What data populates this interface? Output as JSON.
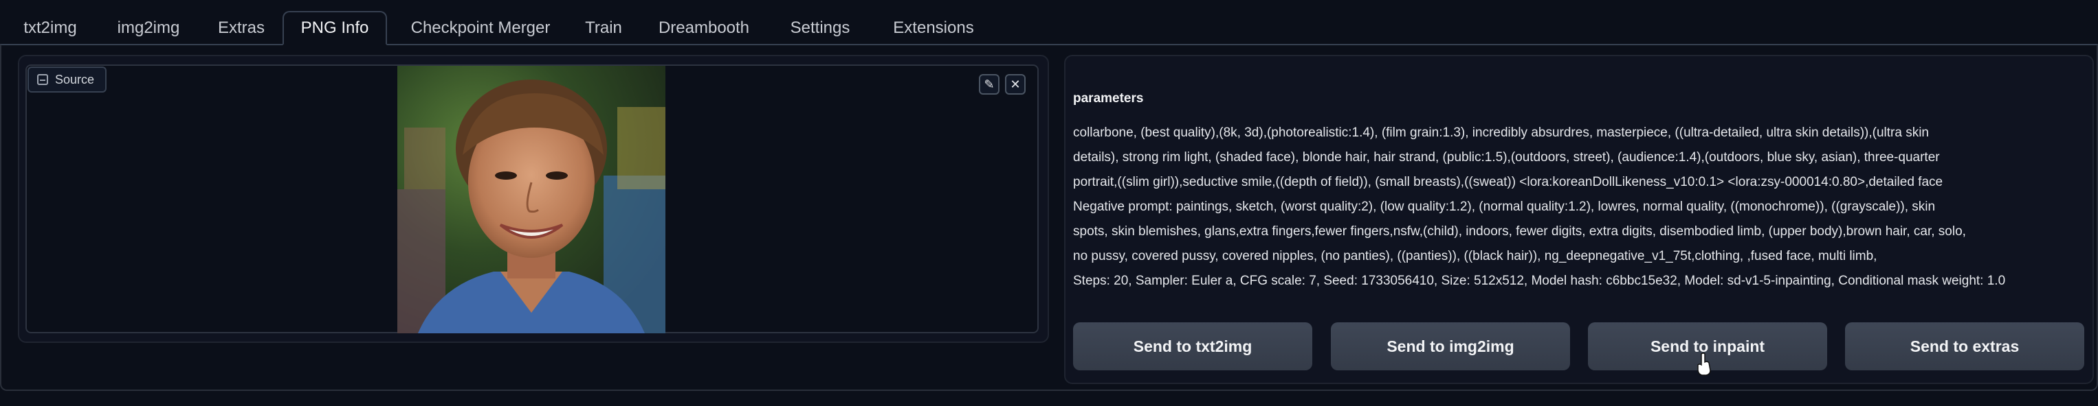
{
  "tabs": [
    {
      "label": "txt2img"
    },
    {
      "label": "img2img"
    },
    {
      "label": "Extras"
    },
    {
      "label": "PNG Info"
    },
    {
      "label": "Checkpoint Merger"
    },
    {
      "label": "Train"
    },
    {
      "label": "Dreambooth"
    },
    {
      "label": "Settings"
    },
    {
      "label": "Extensions"
    }
  ],
  "image_panel": {
    "source_label": "Source",
    "edit_icon": "pencil-icon",
    "close_icon": "close-icon",
    "image_alt": "portrait-photo"
  },
  "info": {
    "title": "parameters",
    "lines": [
      "collarbone, (best quality),(8k, 3d),(photorealistic:1.4), (film grain:1.3), incredibly absurdres, masterpiece, ((ultra-detailed, ultra skin details)),(ultra skin",
      "details), strong rim light, (shaded face), blonde hair, hair strand, (public:1.5),(outdoors, street), (audience:1.4),(outdoors, blue sky, asian), three-quarter",
      "portrait,((slim girl)),seductive smile,((depth of field)), (small breasts),((sweat)) <lora:koreanDollLikeness_v10:0.1> <lora:zsy-000014:0.80>,detailed face",
      "Negative prompt: paintings, sketch, (worst quality:2), (low quality:1.2), (normal quality:1.2), lowres, normal quality, ((monochrome)), ((grayscale)), skin",
      "spots, skin blemishes, glans,extra fingers,fewer fingers,nsfw,(child), indoors, fewer digits, extra digits, disembodied limb, (upper body),brown hair, car, solo,",
      "no pussy, covered pussy, covered nipples, (no panties), ((panties)), ((black hair)), ng_deepnegative_v1_75t,clothing, ,fused face, multi limb,",
      "Steps: 20, Sampler: Euler a, CFG scale: 7, Seed: 1733056410, Size: 512x512, Model hash: c6bbc15e32, Model: sd-v1-5-inpainting, Conditional mask weight: 1.0"
    ]
  },
  "buttons": {
    "txt2img": "Send to txt2img",
    "img2img": "Send to img2img",
    "inpaint": "Send to inpaint",
    "extras": "Send to extras"
  },
  "colors": {
    "background": "#0b0f19",
    "panel": "#0f1320",
    "button": "#374151",
    "text": "#e5e7eb"
  }
}
